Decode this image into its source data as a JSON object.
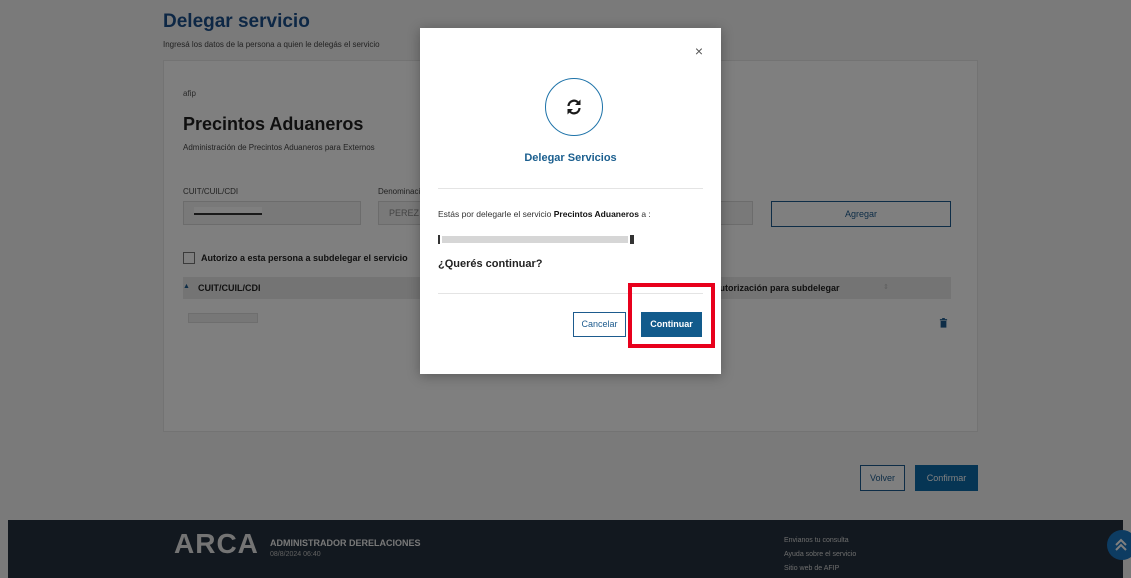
{
  "page": {
    "title": "Delegar servicio",
    "subtitle": "Ingresá los datos de la persona a quien le delegás el servicio"
  },
  "card": {
    "brand": "afip",
    "title": "Precintos Aduaneros",
    "description": "Administración de Precintos Aduaneros para Externos",
    "cuit_label": "CUIT/CUIL/CDI",
    "denominacion_label": "Denominación",
    "denominacion_value": "PEREZ",
    "agregar_label": "Agregar",
    "checkbox_label": "Autorizo a esta persona a subdelegar el servicio",
    "table": {
      "col1": "CUIT/CUIL/CDI",
      "col3": "Autorización para subdelegar"
    }
  },
  "actions": {
    "volver": "Volver",
    "confirmar": "Confirmar"
  },
  "footer": {
    "logo": "ARCA",
    "app_name": "ADMINISTRADOR DERELACIONES",
    "datetime": "08/8/2024 06:40",
    "links": [
      "Envianos tu consulta",
      "Ayuda sobre el servicio",
      "Sitio web de AFIP"
    ]
  },
  "modal": {
    "close": "×",
    "icon": "refresh-icon",
    "title": "Delegar Servicios",
    "message_prefix": "Estás por delegarle el servicio ",
    "service_name": "Precintos Aduaneros",
    "message_suffix": " a :",
    "question": "¿Querés continuar?",
    "cancel": "Cancelar",
    "continue": "Continuar"
  },
  "colors": {
    "primary": "#125b8c",
    "title_blue": "#1a4f8b",
    "highlight": "#e8001c",
    "footer_bg": "#25313e"
  }
}
